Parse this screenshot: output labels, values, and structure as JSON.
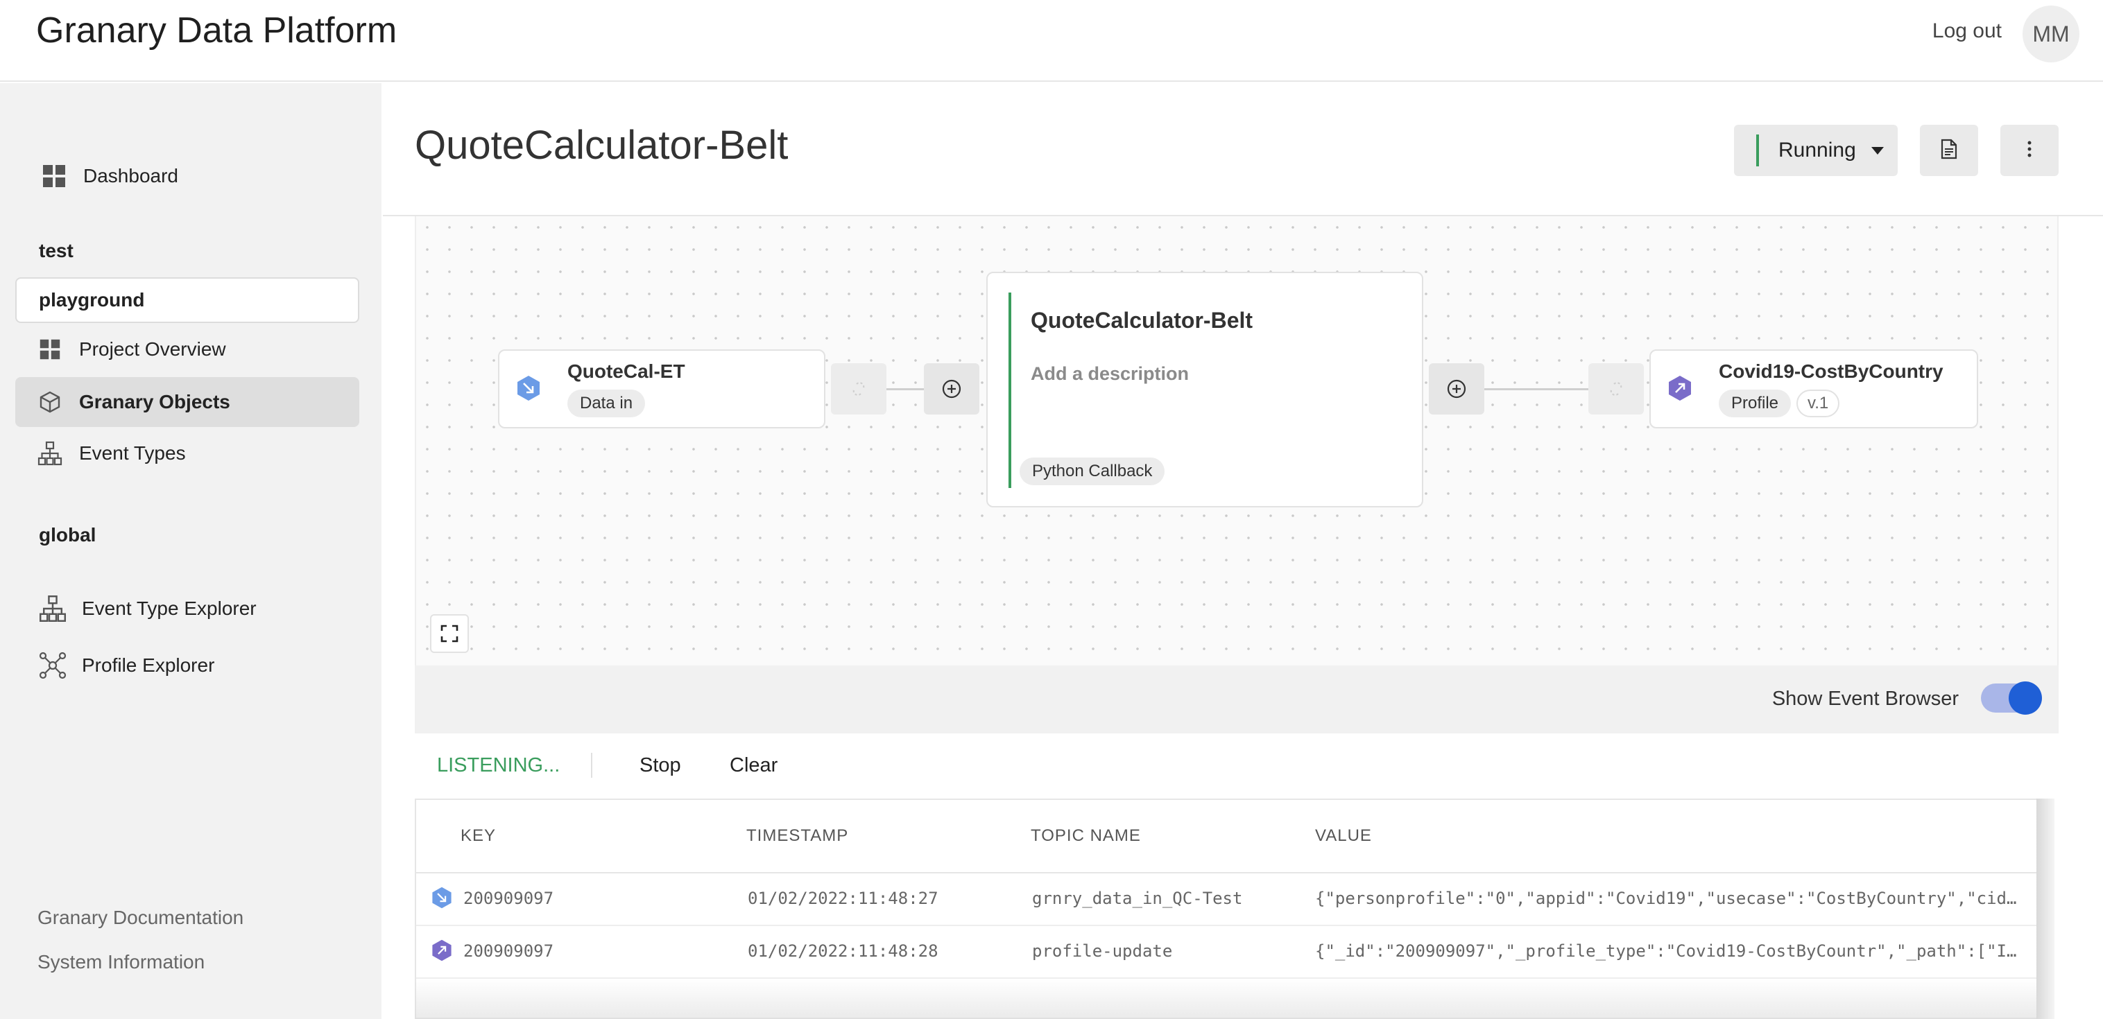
{
  "app": {
    "title": "Granary Data Platform",
    "logout_label": "Log out",
    "avatar_initials": "MM"
  },
  "sidebar": {
    "dashboard": "Dashboard",
    "section_test": "test",
    "project": "playground",
    "project_overview": "Project Overview",
    "granary_objects": "Granary Objects",
    "event_types": "Event Types",
    "section_global": "global",
    "event_type_explorer": "Event Type Explorer",
    "profile_explorer": "Profile Explorer",
    "documentation": "Granary Documentation",
    "system_information": "System Information"
  },
  "header": {
    "title": "QuoteCalculator-Belt",
    "status_label": "Running"
  },
  "canvas": {
    "source": {
      "title": "QuoteCal-ET",
      "tag": "Data in"
    },
    "center": {
      "title": "QuoteCalculator-Belt",
      "description": "Add a description",
      "tag": "Python Callback"
    },
    "target": {
      "title": "Covid19-CostByCountry",
      "tag": "Profile",
      "version": "v.1"
    }
  },
  "event_browser": {
    "toggle_label": "Show Event Browser",
    "status": "LISTENING...",
    "stop_label": "Stop",
    "clear_label": "Clear",
    "columns": [
      "KEY",
      "TIMESTAMP",
      "TOPIC NAME",
      "VALUE"
    ],
    "rows": [
      {
        "key": "200909097",
        "timestamp": "01/02/2022:11:48:27",
        "topic": "grnry_data_in_QC-Test",
        "value": "{\"personprofile\":\"0\",\"appid\":\"Covid19\",\"usecase\":\"CostByCountry\",\"cid\"…"
      },
      {
        "key": "200909097",
        "timestamp": "01/02/2022:11:48:28",
        "topic": "profile-update",
        "value": "{\"_id\":\"200909097\",\"_profile_type\":\"Covid19-CostByCountr\",\"_path\":[\"In…"
      }
    ]
  },
  "colors": {
    "running_accent": "#3a9d5d",
    "data_in_icon": "#6b9be6",
    "profile_icon": "#7a6cc9",
    "toggle": "#1f5fd6"
  },
  "icons": [
    "grid-icon",
    "cube-icon",
    "hierarchy-icon",
    "network-icon",
    "document-icon",
    "more-vertical-icon",
    "plus-circle-icon",
    "unlink-icon",
    "fullscreen-icon",
    "arrow-in-icon",
    "arrow-out-icon"
  ]
}
